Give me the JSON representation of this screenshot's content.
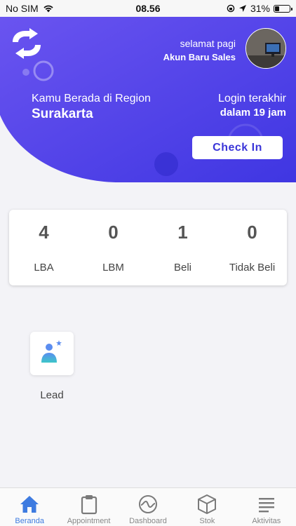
{
  "status_bar": {
    "carrier": "No SIM",
    "time": "08.56",
    "battery": "31%",
    "battery_level": 0.31
  },
  "header": {
    "greeting": "selamat pagi",
    "account_name": "Akun Baru Sales",
    "region_label": "Kamu Berada di Region",
    "region_name": "Surakarta",
    "login_label": "Login terakhir",
    "login_value": "dalam 19 jam",
    "checkin_label": "Check In"
  },
  "stats": [
    {
      "value": "4",
      "label": "LBA"
    },
    {
      "value": "0",
      "label": "LBM"
    },
    {
      "value": "1",
      "label": "Beli"
    },
    {
      "value": "0",
      "label": "Tidak Beli"
    }
  ],
  "menu": {
    "lead_label": "Lead"
  },
  "nav": {
    "items": [
      {
        "label": "Beranda",
        "icon": "home-icon",
        "active": true
      },
      {
        "label": "Appointment",
        "icon": "clipboard-icon",
        "active": false
      },
      {
        "label": "Dashboard",
        "icon": "dashboard-icon",
        "active": false
      },
      {
        "label": "Stok",
        "icon": "box-icon",
        "active": false
      },
      {
        "label": "Aktivitas",
        "icon": "list-icon",
        "active": false
      }
    ]
  },
  "colors": {
    "header_start": "#6a54f0",
    "header_end": "#3f36e2",
    "accent": "#3a35d8",
    "nav_active": "#3e7be0"
  }
}
